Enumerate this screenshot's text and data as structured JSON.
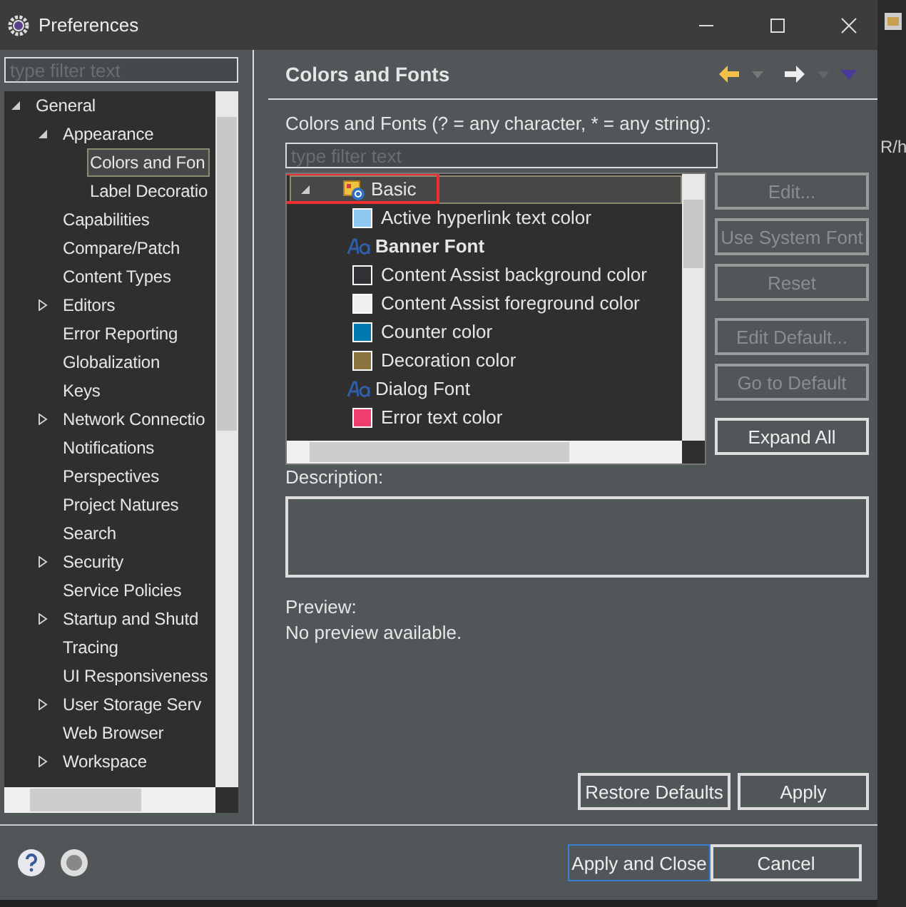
{
  "window": {
    "title": "Preferences"
  },
  "sidebar": {
    "filter_placeholder": "type filter text",
    "items": [
      {
        "label": "General",
        "expanded": true,
        "selected": false,
        "children": [
          {
            "label": "Appearance",
            "expanded": true,
            "selected": false,
            "children": [
              {
                "label": "Colors and Fon",
                "selected": true
              },
              {
                "label": "Label Decoratio",
                "selected": false
              }
            ]
          },
          {
            "label": "Capabilities",
            "selected": false
          },
          {
            "label": "Compare/Patch",
            "selected": false
          },
          {
            "label": "Content Types",
            "selected": false
          },
          {
            "label": "Editors",
            "expanded": false,
            "selected": false
          },
          {
            "label": "Error Reporting",
            "selected": false
          },
          {
            "label": "Globalization",
            "selected": false
          },
          {
            "label": "Keys",
            "selected": false
          },
          {
            "label": "Network Connectio",
            "expanded": false,
            "selected": false
          },
          {
            "label": "Notifications",
            "selected": false
          },
          {
            "label": "Perspectives",
            "selected": false
          },
          {
            "label": "Project Natures",
            "selected": false
          },
          {
            "label": "Search",
            "selected": false
          },
          {
            "label": "Security",
            "expanded": false,
            "selected": false
          },
          {
            "label": "Service Policies",
            "selected": false
          },
          {
            "label": "Startup and Shutd",
            "expanded": false,
            "selected": false
          },
          {
            "label": "Tracing",
            "selected": false
          },
          {
            "label": "UI Responsiveness",
            "selected": false
          },
          {
            "label": "User Storage Serv",
            "expanded": false,
            "selected": false
          },
          {
            "label": "Web Browser",
            "selected": false
          },
          {
            "label": "Workspace",
            "expanded": false,
            "selected": false
          }
        ]
      }
    ]
  },
  "page": {
    "title": "Colors and Fonts",
    "filter_label": "Colors and Fonts (? = any character, * = any string):",
    "filter_placeholder": "type filter text",
    "tree": [
      {
        "label": "Basic",
        "expanded": true,
        "annotated": true,
        "children": [
          {
            "kind": "color",
            "label": "Active hyperlink text color",
            "color": "#8ec8f0"
          },
          {
            "kind": "font",
            "label": "Banner Font",
            "bold": true
          },
          {
            "kind": "color",
            "label": "Content Assist background color",
            "color": "#2f3134"
          },
          {
            "kind": "color",
            "label": "Content Assist foreground color",
            "color": "#efefef"
          },
          {
            "kind": "color",
            "label": "Counter color",
            "color": "#0079b0"
          },
          {
            "kind": "color",
            "label": "Decoration color",
            "color": "#8b7340"
          },
          {
            "kind": "font",
            "label": "Dialog Font",
            "bold": false
          },
          {
            "kind": "color",
            "label": "Error text color",
            "color": "#f03f6e"
          }
        ]
      }
    ],
    "side_buttons": [
      {
        "label": "Edit...",
        "disabled": true
      },
      {
        "label": "Use System Font",
        "disabled": true
      },
      {
        "label": "Reset",
        "disabled": true
      },
      {
        "label": "Edit Default...",
        "disabled": true
      },
      {
        "label": "Go to Default",
        "disabled": true
      },
      {
        "label": "Expand All",
        "disabled": false
      }
    ],
    "description_label": "Description:",
    "preview_label": "Preview:",
    "preview_text": "No preview available.",
    "page_buttons": [
      "Restore Defaults",
      "Apply"
    ]
  },
  "dialog_buttons": [
    {
      "label": "Apply and Close",
      "default": true
    },
    {
      "label": "Cancel",
      "default": false
    }
  ],
  "background_text": "R/h"
}
